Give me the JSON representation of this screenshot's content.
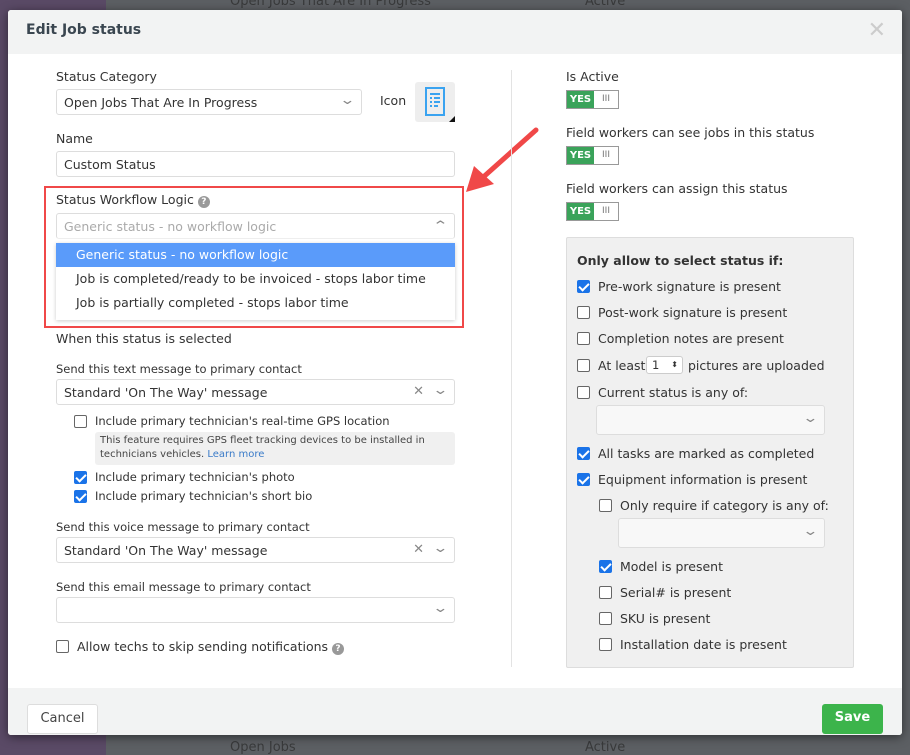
{
  "background": {
    "row1_name": "Open Jobs That Are In Progress",
    "row1_status": "Active",
    "row2_name": "Open Jobs",
    "row2_status": "Active"
  },
  "modal": {
    "title": "Edit Job status",
    "close_icon": "close-icon",
    "left": {
      "status_category_label": "Status Category",
      "status_category_value": "Open Jobs That Are In Progress",
      "icon_label": "Icon",
      "icon_name": "document-list-icon",
      "name_label": "Name",
      "name_value": "Custom Status",
      "workflow_label": "Status Workflow Logic",
      "workflow_placeholder": "Generic status - no workflow logic",
      "workflow_options": [
        "Generic status - no workflow logic",
        "Job is completed/ready to be invoiced - stops labor time",
        "Job is partially completed - stops labor time"
      ],
      "when_selected": "When this status is selected",
      "text_label": "Send this text message to primary contact",
      "text_value": "Standard 'On The Way' message",
      "gps_label": "Include primary technician's real-time GPS location",
      "gps_checked": false,
      "gps_note": "This feature requires GPS fleet tracking devices to be installed in technicians vehicles.",
      "learn_more": "Learn more",
      "photo_label": "Include primary technician's photo",
      "photo_checked": true,
      "bio_label": "Include primary technician's short bio",
      "bio_checked": true,
      "voice_label": "Send this voice message to primary contact",
      "voice_value": "Standard 'On The Way' message",
      "email_label": "Send this email message to primary contact",
      "email_value": "",
      "skip_label": "Allow techs to skip sending notifications",
      "skip_checked": false
    },
    "right": {
      "toggles": [
        {
          "label": "Is Active",
          "on": true
        },
        {
          "label": "Field workers can see jobs in this status",
          "on": true
        },
        {
          "label": "Field workers can assign this status",
          "on": true
        }
      ],
      "toggle_yes": "YES",
      "toggle_no": "III",
      "box_title": "Only allow to select status if:",
      "prework": "Pre-work signature is present",
      "postwork": "Post-work signature is present",
      "notes": "Completion notes are present",
      "atleast": "At least",
      "pictures_count": "1",
      "pictures": "pictures are uploaded",
      "current_status": "Current status is any of:",
      "tasks": "All tasks are marked as completed",
      "equipment": "Equipment information is present",
      "category": "Only require if category is any of:",
      "model": "Model is present",
      "serial": "Serial# is present",
      "sku": "SKU is present",
      "install": "Installation date is present"
    },
    "footer": {
      "cancel": "Cancel",
      "save": "Save"
    }
  },
  "colors": {
    "accent_green": "#3cb44b",
    "highlight_blue": "#5a9bfa",
    "annotation_red": "#f04848"
  }
}
